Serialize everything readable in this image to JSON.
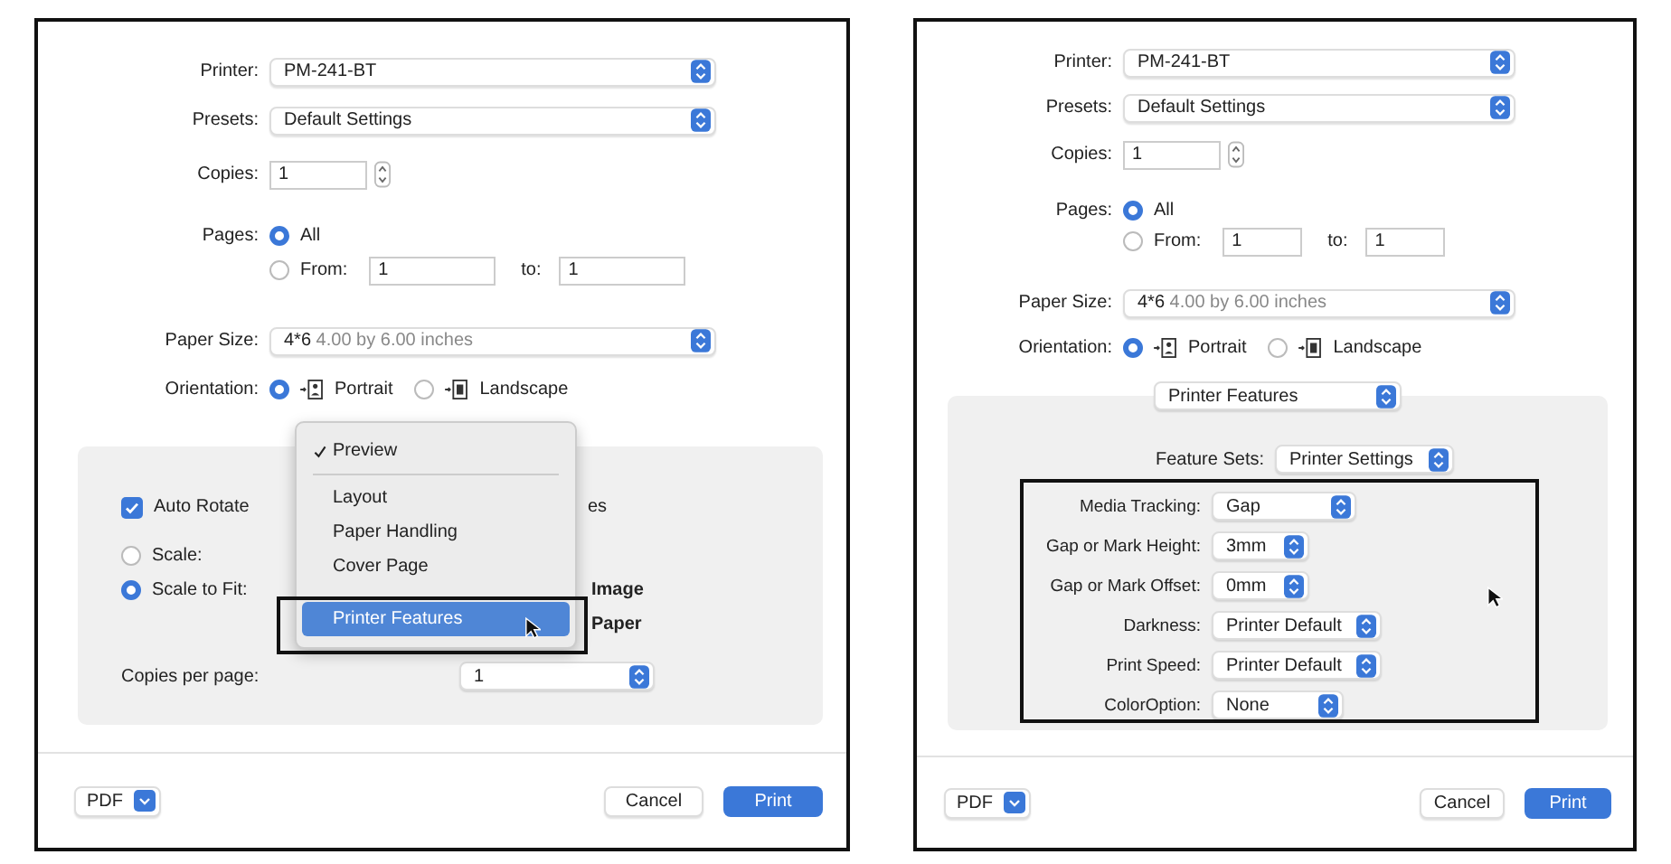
{
  "dialogs": [
    {
      "printer": {
        "label": "Printer:",
        "value": "PM-241-BT"
      },
      "presets": {
        "label": "Presets:",
        "value": "Default Settings"
      },
      "copies": {
        "label": "Copies:",
        "value": "1"
      },
      "pages": {
        "label": "Pages:",
        "options": [
          {
            "label": "All",
            "selected": true
          },
          {
            "label": "From:",
            "selected": false
          }
        ],
        "from": "1",
        "to_label": "to:",
        "to": "1"
      },
      "paper_size": {
        "label": "Paper Size:",
        "value": "4*6",
        "detail": "4.00 by 6.00 inches"
      },
      "orientation": {
        "label": "Orientation:",
        "options": [
          {
            "label": "Portrait",
            "selected": true
          },
          {
            "label": "Landscape",
            "selected": false
          }
        ]
      },
      "panel": {
        "kind": "layout",
        "auto_rotate": {
          "label": "Auto Rotate",
          "checked": true
        },
        "fragments": [
          "es",
          "Image",
          "Paper"
        ],
        "scale_options": [
          {
            "label": "Scale:",
            "selected": false
          },
          {
            "label": "Scale to Fit:",
            "selected": true
          }
        ],
        "copies_per_page": {
          "label": "Copies per page:",
          "value": "1"
        },
        "menu": [
          {
            "items": [
              {
                "label": "Preview",
                "checked": true,
                "selected": false
              }
            ]
          },
          {
            "items": [
              {
                "label": "Layout",
                "checked": false,
                "selected": false
              },
              {
                "label": "Paper Handling",
                "checked": false,
                "selected": false
              },
              {
                "label": "Cover Page",
                "checked": false,
                "selected": false
              },
              {
                "label": "Printer Features",
                "checked": false,
                "selected": true
              }
            ]
          }
        ]
      },
      "footer": {
        "pdf": "PDF",
        "cancel": "Cancel",
        "print": "Print"
      }
    },
    {
      "printer": {
        "label": "Printer:",
        "value": "PM-241-BT"
      },
      "presets": {
        "label": "Presets:",
        "value": "Default Settings"
      },
      "copies": {
        "label": "Copies:",
        "value": "1"
      },
      "pages": {
        "label": "Pages:",
        "options": [
          {
            "label": "All",
            "selected": true
          },
          {
            "label": "From:",
            "selected": false
          }
        ],
        "from": "1",
        "to_label": "to:",
        "to": "1"
      },
      "paper_size": {
        "label": "Paper Size:",
        "value": "4*6",
        "detail": "4.00 by 6.00 inches"
      },
      "orientation": {
        "label": "Orientation:",
        "options": [
          {
            "label": "Portrait",
            "selected": true
          },
          {
            "label": "Landscape",
            "selected": false
          }
        ]
      },
      "panel": {
        "kind": "features",
        "section": "Printer Features",
        "feature_sets": {
          "label": "Feature Sets:",
          "value": "Printer Settings"
        },
        "features": [
          {
            "label": "Media Tracking:",
            "value": "Gap"
          },
          {
            "label": "Gap or Mark Height:",
            "value": "3mm"
          },
          {
            "label": "Gap or Mark Offset:",
            "value": "0mm"
          },
          {
            "label": "Darkness:",
            "value": "Printer Default"
          },
          {
            "label": "Print Speed:",
            "value": "Printer Default"
          },
          {
            "label": "ColorOption:",
            "value": "None"
          }
        ]
      },
      "footer": {
        "pdf": "PDF",
        "cancel": "Cancel",
        "print": "Print"
      }
    }
  ]
}
